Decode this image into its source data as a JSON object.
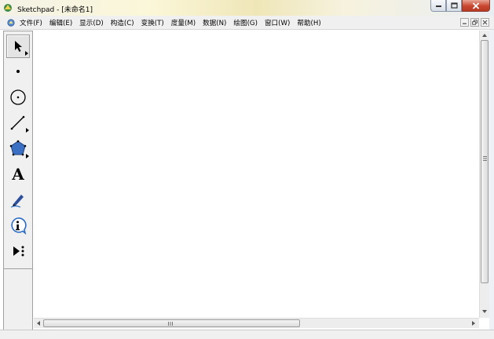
{
  "window": {
    "title": "Sketchpad - [未命名1]"
  },
  "menubar": {
    "items": [
      {
        "label": "文件(F)"
      },
      {
        "label": "编辑(E)"
      },
      {
        "label": "显示(D)"
      },
      {
        "label": "构造(C)"
      },
      {
        "label": "变换(T)"
      },
      {
        "label": "度量(M)"
      },
      {
        "label": "数据(N)"
      },
      {
        "label": "绘图(G)"
      },
      {
        "label": "窗口(W)"
      },
      {
        "label": "帮助(H)"
      }
    ]
  },
  "toolbox": {
    "tools": [
      {
        "icon": "selection-arrow-icon",
        "active": true
      },
      {
        "icon": "point-icon"
      },
      {
        "icon": "compass-circle-icon"
      },
      {
        "icon": "straightedge-icon"
      },
      {
        "icon": "polygon-icon"
      },
      {
        "icon": "text-icon",
        "glyph": "A"
      },
      {
        "icon": "marker-pen-icon"
      },
      {
        "icon": "information-icon"
      },
      {
        "icon": "custom-tools-icon"
      }
    ]
  },
  "colors": {
    "polygon_fill": "#3b6fc4",
    "close_button": "#c8462f",
    "info_icon": "#2b6cc4"
  }
}
